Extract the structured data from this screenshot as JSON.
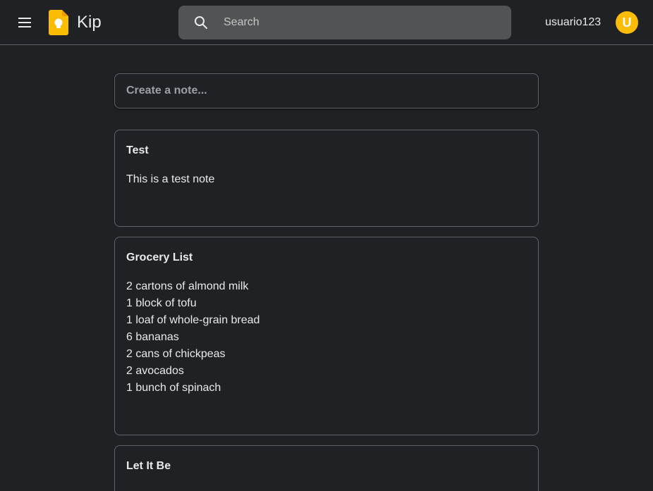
{
  "header": {
    "app_title": "Kip",
    "menu_icon": "hamburger-menu-icon",
    "logo_icon": "keep-lightbulb-icon",
    "logo_color": "#fbbc04",
    "search": {
      "icon": "search-icon",
      "placeholder": "Search",
      "value": ""
    },
    "username": "usuario123",
    "avatar_initial": "U",
    "avatar_color": "#fbbc04"
  },
  "create_note": {
    "placeholder": "Create a note..."
  },
  "notes": [
    {
      "title": "Test",
      "lines": [
        "This is a test note"
      ]
    },
    {
      "title": "Grocery List",
      "lines": [
        "2 cartons of almond milk",
        "1 block of tofu",
        "1 loaf of whole-grain bread",
        "6 bananas",
        "2 cans of chickpeas",
        "2 avocados",
        "1 bunch of spinach"
      ]
    },
    {
      "title": "Let It Be",
      "lines": []
    }
  ]
}
